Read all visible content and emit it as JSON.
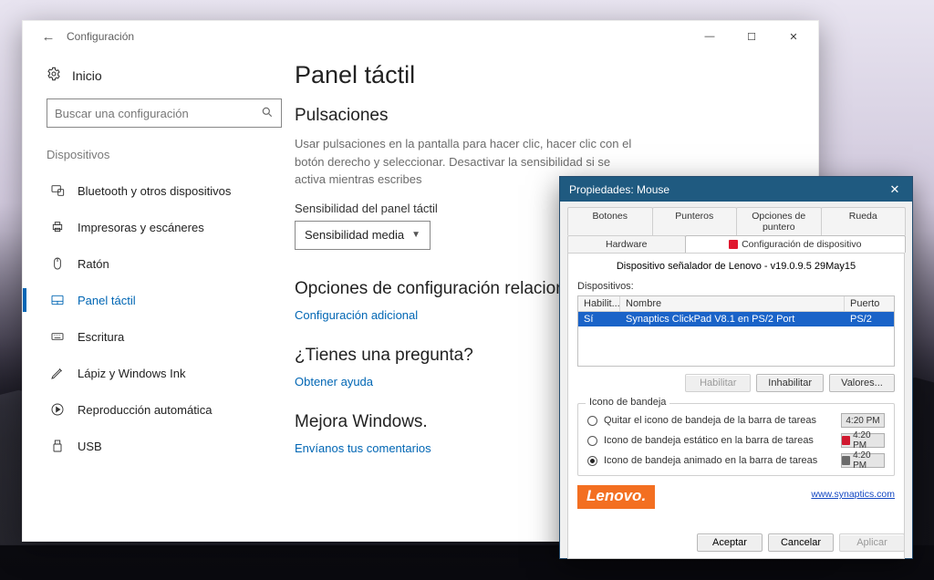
{
  "settings": {
    "window_title": "Configuración",
    "home_label": "Inicio",
    "search_placeholder": "Buscar una configuración",
    "group_label": "Dispositivos",
    "nav": [
      {
        "icon": "bluetooth",
        "label": "Bluetooth y otros dispositivos"
      },
      {
        "icon": "printer",
        "label": "Impresoras y escáneres"
      },
      {
        "icon": "mouse",
        "label": "Ratón"
      },
      {
        "icon": "touchpad",
        "label": "Panel táctil"
      },
      {
        "icon": "keyboard",
        "label": "Escritura"
      },
      {
        "icon": "pen",
        "label": "Lápiz y Windows Ink"
      },
      {
        "icon": "autoplay",
        "label": "Reproducción automática"
      },
      {
        "icon": "usb",
        "label": "USB"
      }
    ],
    "main": {
      "title": "Panel táctil",
      "h2": "Pulsaciones",
      "desc": "Usar pulsaciones en la pantalla para hacer clic, hacer clic con el botón derecho y seleccionar. Desactivar la sensibilidad si se activa mientras escribes",
      "sens_label": "Sensibilidad del panel táctil",
      "sens_value": "Sensibilidad media",
      "h3a": "Opciones de configuración relacionadas",
      "link1": "Configuración adicional",
      "h3b": "¿Tienes una pregunta?",
      "link2": "Obtener ayuda",
      "h3c": "Mejora Windows.",
      "link3": "Envíanos tus comentarios"
    }
  },
  "mouse_dialog": {
    "title": "Propiedades: Mouse",
    "tabs_row1": [
      "Botones",
      "Punteros",
      "Opciones de puntero",
      "Rueda"
    ],
    "tabs_row2": {
      "hardware": "Hardware",
      "config": "Configuración de dispositivo"
    },
    "device_title": "Dispositivo señalador de Lenovo - v19.0.9.5 29May15",
    "devices_label": "Dispositivos:",
    "columns": {
      "c1": "Habilit...",
      "c2": "Nombre",
      "c3": "Puerto"
    },
    "row": {
      "c1": "Sí",
      "c2": "Synaptics ClickPad V8.1 en PS/2 Port",
      "c3": "PS/2"
    },
    "btn_enable": "Habilitar",
    "btn_disable": "Inhabilitar",
    "btn_values": "Valores...",
    "tray_legend": "Icono de bandeja",
    "radios": [
      "Quitar el icono de bandeja de la barra de tareas",
      "Icono de bandeja estático en la barra de tareas",
      "Icono de bandeja animado en la barra de tareas"
    ],
    "clock": "4:20 PM",
    "brand": "Lenovo.",
    "syn_link": "www.synaptics.com",
    "ok": "Aceptar",
    "cancel": "Cancelar",
    "apply": "Aplicar"
  }
}
